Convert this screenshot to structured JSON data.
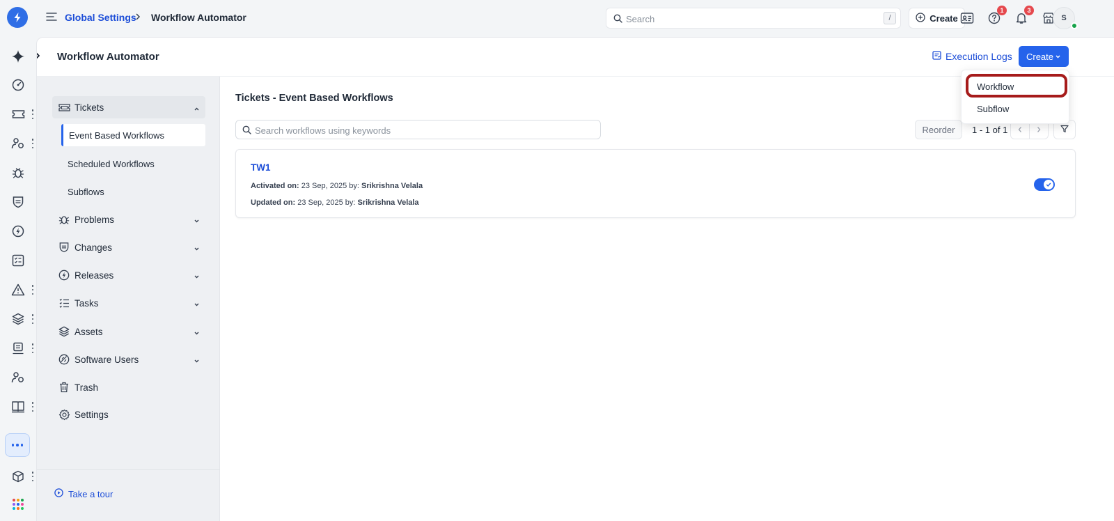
{
  "topbar": {
    "breadcrumb_parent": "Global Settings",
    "breadcrumb_current": "Workflow Automator",
    "search_placeholder": "Search",
    "search_shortcut": "/",
    "create_label": "Create",
    "help_badge": "1",
    "notifications_badge": "3",
    "avatar_initial": "S"
  },
  "header": {
    "title": "Workflow Automator",
    "execution_logs_label": "Execution Logs",
    "create_label": "Create"
  },
  "create_menu": {
    "items": [
      {
        "label": "Workflow",
        "highlighted": true
      },
      {
        "label": "Subflow"
      }
    ],
    "highlight_color": "#a61b1b"
  },
  "sidebar": {
    "groups": [
      {
        "label": "Tickets",
        "icon": "ticket-icon",
        "expanded": true
      },
      {
        "label": "Problems",
        "icon": "bug-icon"
      },
      {
        "label": "Changes",
        "icon": "shield-icon"
      },
      {
        "label": "Releases",
        "icon": "bolt-icon"
      },
      {
        "label": "Tasks",
        "icon": "list-icon"
      },
      {
        "label": "Assets",
        "icon": "layers-icon"
      },
      {
        "label": "Software Users",
        "icon": "software-icon"
      },
      {
        "label": "Trash",
        "icon": "trash-icon"
      },
      {
        "label": "Settings",
        "icon": "gear-icon"
      }
    ],
    "ticket_subitems": [
      {
        "label": "Event Based Workflows",
        "active": true
      },
      {
        "label": "Scheduled Workflows"
      },
      {
        "label": "Subflows"
      }
    ],
    "tour_label": "Take a tour"
  },
  "main": {
    "title": "Tickets - Event Based Workflows",
    "search_placeholder": "Search workflows using keywords",
    "reorder_label": "Reorder",
    "pagination": "1 - 1 of 1",
    "workflows": [
      {
        "name": "TW1",
        "activated_label": "Activated on:",
        "activated_date": "23 Sep, 2025",
        "activated_by_label": "by:",
        "activated_by": "Srikrishna Velala",
        "updated_label": "Updated on:",
        "updated_date": "23 Sep, 2025",
        "updated_by_label": "by:",
        "updated_by": "Srikrishna Velala",
        "enabled": true
      }
    ]
  },
  "colors": {
    "accent": "#2563eb",
    "link": "#1d4ed8",
    "badge": "#e5484d",
    "status_online": "#16a34a"
  }
}
